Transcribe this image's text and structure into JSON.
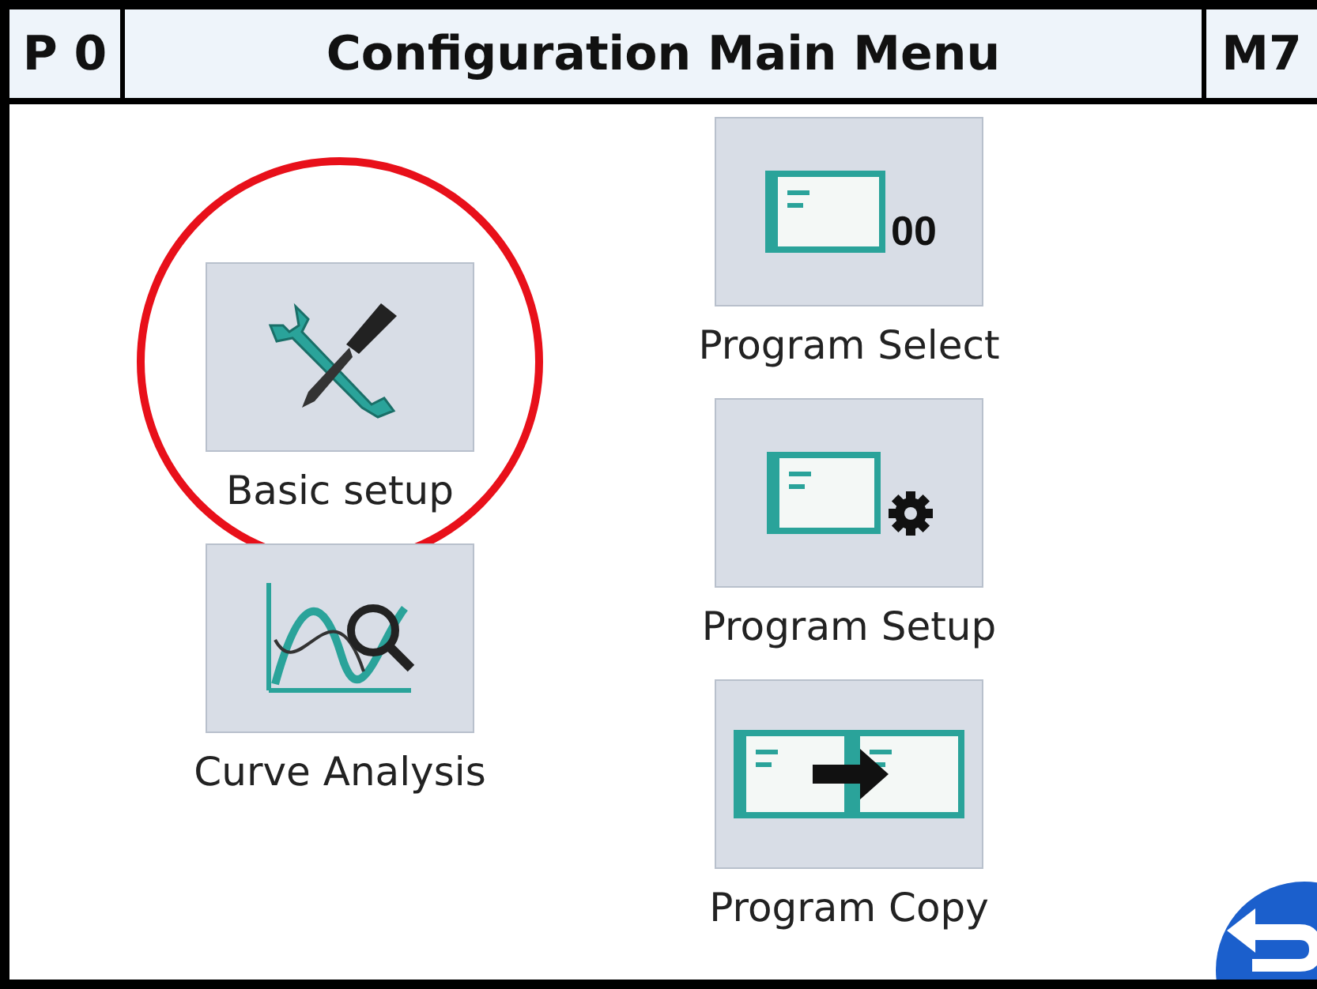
{
  "title_bar": {
    "left": "P 0",
    "title": "Configuration Main Menu",
    "right": "M7"
  },
  "columns": [
    {
      "items": [
        {
          "label": "Basic setup",
          "kind": "tools",
          "circled": true
        },
        {
          "label": "Curve Analysis",
          "kind": "curve",
          "circled": false
        }
      ]
    },
    {
      "items": [
        {
          "label": "Program Select",
          "kind": "select",
          "icon_text": "00",
          "circled": false
        },
        {
          "label": "Program Setup",
          "kind": "setup",
          "circled": false
        },
        {
          "label": "Program Copy",
          "kind": "copy",
          "circled": false
        }
      ]
    }
  ]
}
